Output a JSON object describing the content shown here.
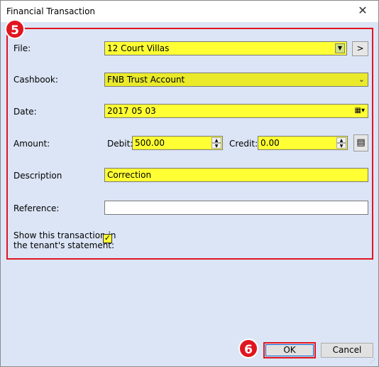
{
  "window": {
    "title": "Financial Transaction"
  },
  "badges": {
    "panel": "5",
    "ok": "6"
  },
  "form": {
    "file_label": "File:",
    "file_value": "12 Court Villas",
    "file_next": ">",
    "cashbook_label": "Cashbook:",
    "cashbook_value": "FNB Trust Account",
    "date_label": "Date:",
    "date_value": "2017 05 03",
    "amount_label": "Amount:",
    "debit_label": "Debit:",
    "debit_value": "500.00",
    "credit_label": "Credit:",
    "credit_value": "0.00",
    "description_label": "Description",
    "description_value": "Correction",
    "reference_label": "Reference:",
    "reference_value": "",
    "statement_label_1": "Show this transaction in",
    "statement_label_2": "the tenant's statement:",
    "statement_checked": true
  },
  "buttons": {
    "ok": "OK",
    "cancel": "Cancel"
  },
  "colors": {
    "highlight": "#ffff33",
    "annotation": "#e0151f",
    "window_bg": "#dbe5f6"
  }
}
